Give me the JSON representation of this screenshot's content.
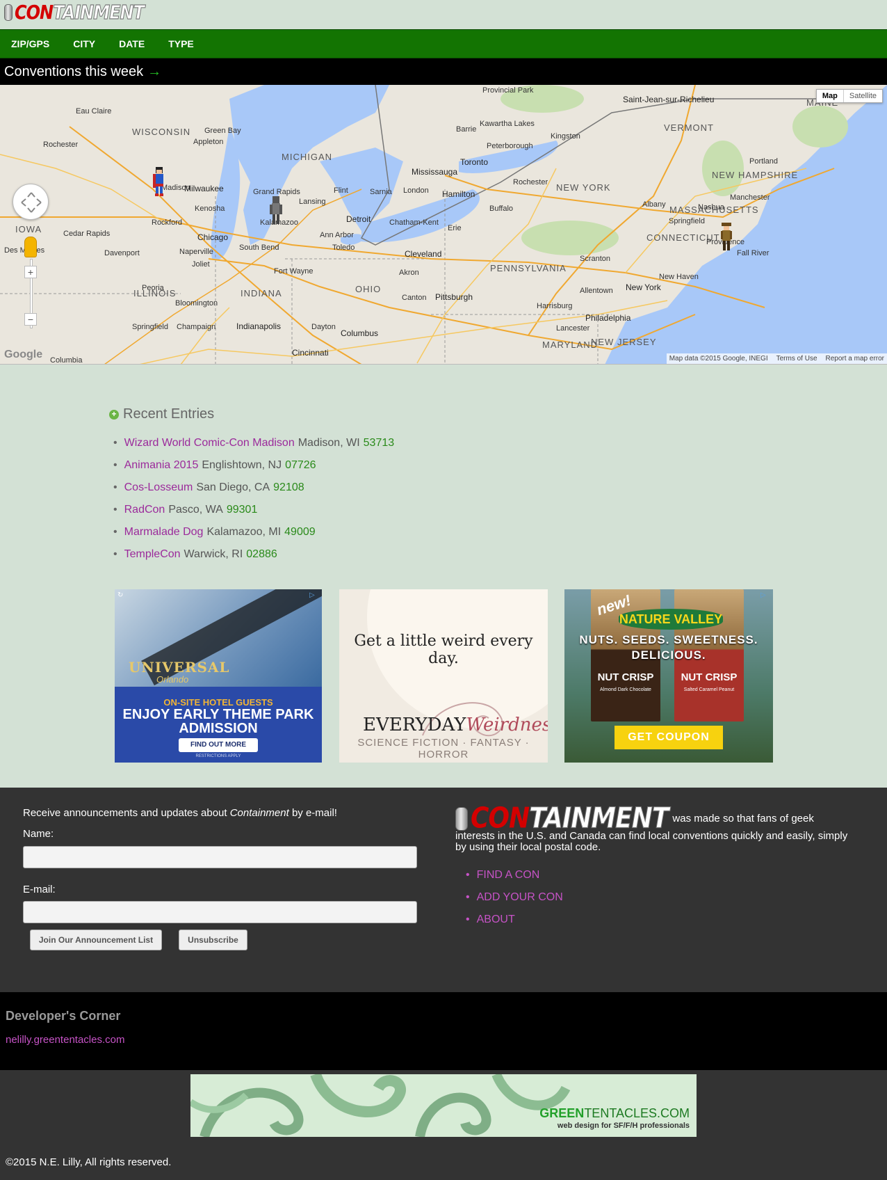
{
  "header": {
    "logo_con": "CON",
    "logo_tain": "TAINMENT"
  },
  "nav": [
    "ZIP/GPS",
    "CITY",
    "DATE",
    "TYPE"
  ],
  "week_bar": {
    "title": "Conventions this week",
    "arrow": "→"
  },
  "map": {
    "type_buttons": {
      "map": "Map",
      "satellite": "Satellite"
    },
    "footer": {
      "data": "Map data ©2015 Google, INEGI",
      "terms": "Terms of Use",
      "report": "Report a map error"
    },
    "logo": "Google",
    "labels_big": [
      {
        "text": "WISCONSIN"
      },
      {
        "text": "MICHIGAN"
      },
      {
        "text": "IOWA"
      },
      {
        "text": "ILLINOIS"
      },
      {
        "text": "INDIANA"
      },
      {
        "text": "OHIO"
      },
      {
        "text": "PENNSYLVANIA"
      },
      {
        "text": "NEW YORK"
      },
      {
        "text": "VERMONT"
      },
      {
        "text": "NEW HAMPSHIRE"
      },
      {
        "text": "MASSACHUSETTS"
      },
      {
        "text": "CONNECTICUT"
      },
      {
        "text": "MAINE"
      },
      {
        "text": "MARYLAND"
      },
      {
        "text": "NEW JERSEY"
      }
    ],
    "labels_city": [
      "Eau Claire",
      "Green Bay",
      "Appleton",
      "Rochester",
      "Madison",
      "Milwaukee",
      "Kenosha",
      "Rockford",
      "Cedar Rapids",
      "Des Moines",
      "Davenport",
      "Naperville",
      "Joliet",
      "Chicago",
      "South Bend",
      "Grand Rapids",
      "Lansing",
      "Kalamazoo",
      "Flint",
      "Detroit",
      "Ann Arbor",
      "Toledo",
      "Fort Wayne",
      "Peoria",
      "Bloomington",
      "Springfield",
      "Champaign",
      "Indianapolis",
      "Columbia",
      "Cincinnati",
      "Dayton",
      "Columbus",
      "Canton",
      "Akron",
      "Cleveland",
      "Pittsburgh",
      "Erie",
      "Sarnia",
      "London",
      "Chatham-Kent",
      "Hamilton",
      "Mississauga",
      "Toronto",
      "Barrie",
      "Kawartha Lakes",
      "Peterborough",
      "Kingston",
      "Buffalo",
      "Rochester",
      "Albany",
      "Scranton",
      "Allentown",
      "Harrisburg",
      "Lancester",
      "Philadelphia",
      "New York",
      "New Haven",
      "Springfield",
      "Providence",
      "Fall River",
      "Manchester",
      "Nashua",
      "Portland",
      "Saint-Jean-sur-Richelieu",
      "Provincial Park"
    ]
  },
  "recent": {
    "heading": "Recent Entries",
    "entries": [
      {
        "name": "Wizard World Comic-Con Madison",
        "loc": "Madison, WI",
        "zip": "53713"
      },
      {
        "name": "Animania 2015",
        "loc": "Englishtown, NJ",
        "zip": "07726"
      },
      {
        "name": "Cos-Losseum",
        "loc": "San Diego, CA",
        "zip": "92108"
      },
      {
        "name": "RadCon",
        "loc": "Pasco, WA",
        "zip": "99301"
      },
      {
        "name": "Marmalade Dog",
        "loc": "Kalamazoo, MI",
        "zip": "49009"
      },
      {
        "name": "TempleCon",
        "loc": "Warwick, RI",
        "zip": "02886"
      }
    ]
  },
  "ads": {
    "universal": {
      "brand": "UNIVERSAL",
      "sub": "Orlando",
      "l1": "ON-SITE HOTEL GUESTS",
      "l2": "ENJOY EARLY THEME PARK ADMISSION",
      "btn": "FIND OUT MORE",
      "fine": "RESTRICTIONS APPLY"
    },
    "weird": {
      "line": "Get a little weird every day.",
      "brand_a": "EVERYDAY",
      "brand_b": "Weirdness",
      "genres": "SCIENCE FICTION · FANTASY · HORROR"
    },
    "nature": {
      "new": "new!",
      "brand": "NATURE VALLEY",
      "tag": "NUTS. SEEDS. SWEETNESS. DELICIOUS.",
      "n1": "NUT CRISP",
      "n1_sub": "Almond Dark Chocolate",
      "n2": "NUT CRISP",
      "n2_sub": "Salted Caramel Peanut",
      "btn": "GET COUPON"
    }
  },
  "newsletter": {
    "intro_a": "Receive announcements and updates about ",
    "intro_em": "Containment",
    "intro_b": " by e-mail!",
    "name_label": "Name:",
    "email_label": "E-mail:",
    "join_btn": "Join Our Announcement List",
    "unsub_btn": "Unsubscribe"
  },
  "about": {
    "text": "was made so that fans of geek interests in the U.S. and Canada can find local conventions quickly and easily, simply by using their local postal code.",
    "links": [
      "FIND A CON",
      "ADD YOUR CON",
      "ABOUT"
    ]
  },
  "dev": {
    "title": "Developer's Corner",
    "link": "nelilly.greententacles.com"
  },
  "footer": {
    "gt_brand_a": "GREEN",
    "gt_brand_b": "TENTACLES.COM",
    "gt_sub": "web design for SF/F/H professionals",
    "copyright": "©2015 N.E. Lilly, All rights reserved."
  },
  "colors": {
    "nav_green": "#137402",
    "link_purple": "#9b2a9b",
    "zip_green": "#2a8a1a",
    "logo_red": "#d40000"
  }
}
